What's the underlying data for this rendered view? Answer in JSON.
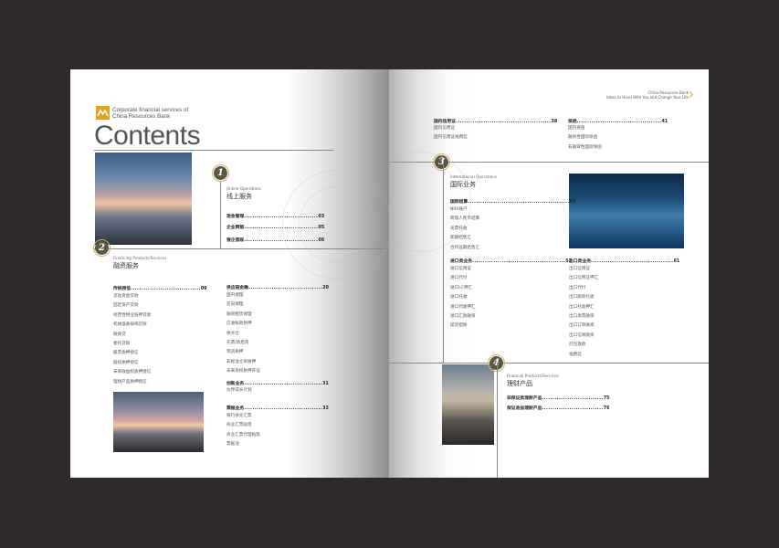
{
  "brand": {
    "line1": "Corporate financial services of",
    "line2": "China Resources Bank",
    "corner_line1": "China Resources Bank",
    "corner_line2": "Ideas to Hand With You and Change Your Life"
  },
  "title": "Contents",
  "sections": {
    "s1": {
      "number": "1",
      "en": "Online Operations",
      "cn": "线上服务",
      "entries": [
        {
          "label": "现金管理",
          "page": "03"
        },
        {
          "label": "企业网银",
          "page": "05"
        },
        {
          "label": "银企直联",
          "page": "06"
        }
      ]
    },
    "s2": {
      "number": "2",
      "en": "Financing Products/Services",
      "cn": "融资服务",
      "col1": {
        "label": "传统授信",
        "page": "09",
        "items": [
          "流动资金贷款",
          "固定资产贷款",
          "经营性物业抵押贷款",
          "机械设备按揭贷款",
          "联保贷",
          "委托贷款",
          "股票质押授信",
          "股权质押授信",
          "未来收益权质押授信",
          "理财产品质押授信"
        ]
      },
      "col2": {
        "label": "供应链金融",
        "page": "20",
        "items": [
          "国内保理",
          "反向保理",
          "融资租赁保理",
          "应收账款质押",
          "保兑仓",
          "先票/款后货",
          "现货质押",
          "非标准仓单质押",
          "未来货权质押开证"
        ]
      },
      "col2b": {
        "label": "创新业务",
        "page": "31",
        "items": [
          "伙伴成长计划"
        ]
      },
      "col2c": {
        "label": "票据业务",
        "page": "33",
        "items": [
          "银行承兑汇票",
          "商业汇票贴现",
          "商业汇票代理贴现",
          "票据池"
        ]
      }
    },
    "s3": {
      "number": "3",
      "en": "International Operations",
      "cn": "国际业务",
      "top1": {
        "label": "国内信用证",
        "page": "38",
        "items": [
          "国内信用证",
          "国内信用证福费廷"
        ]
      },
      "top2": {
        "label": "保函",
        "page": "41",
        "items": [
          "国内保函",
          "融资性国际保函",
          "非融资性国际保函"
        ]
      },
      "col1": {
        "label": "国际结算",
        "page": "47",
        "items": [
          "NRA账户",
          "跨境人民币结算",
          "光票托收",
          "即期结售汇",
          "合作远期结售汇"
        ]
      },
      "col1b": {
        "label": "进口类业务",
        "page": "53",
        "items": [
          "进口信用证",
          "进口代付",
          "进口LC押汇",
          "进口托收",
          "进口代收押汇",
          "进口汇款融资",
          "提货担保"
        ]
      },
      "col2": {
        "label": "出口类业务",
        "page": "61",
        "items": [
          "出口信用证",
          "出口信用证押汇",
          "出口代付",
          "出口跟单托收",
          "出口托收押汇",
          "出口发票融资",
          "出口订单融资",
          "出口信保融资",
          "打包放款",
          "福费廷"
        ]
      }
    },
    "s4": {
      "number": "4",
      "en": "Financial Products/Services",
      "cn": "理财产品",
      "entries": [
        {
          "label": "非保证类理财产品",
          "page": "75"
        },
        {
          "label": "保证收益理财产品",
          "page": "76"
        }
      ]
    }
  },
  "colors": {
    "background": "#2d2a29",
    "accent": "#e7a020",
    "badge": "#5b5545"
  }
}
